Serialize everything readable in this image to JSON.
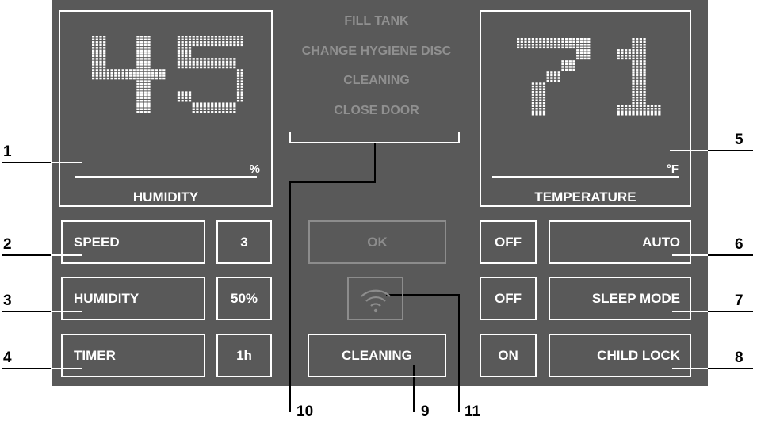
{
  "messages": [
    "FILL TANK",
    "CHANGE HYGIENE DISC",
    "CLEANING",
    "CLOSE DOOR"
  ],
  "humidity_display": {
    "value": "45",
    "unit": "%",
    "title": "HUMIDITY"
  },
  "temperature_display": {
    "value": "71",
    "unit": "°F",
    "title": "TEMPERATURE"
  },
  "left_controls": [
    {
      "label": "SPEED",
      "value": "3"
    },
    {
      "label": "HUMIDITY",
      "value": "50%"
    },
    {
      "label": "TIMER",
      "value": "1h"
    }
  ],
  "center": {
    "ok_label": "OK",
    "cleaning_label": "CLEANING",
    "wifi_icon": "wifi-icon"
  },
  "right_controls": [
    {
      "state": "OFF",
      "label": "AUTO"
    },
    {
      "state": "OFF",
      "label": "SLEEP MODE"
    },
    {
      "state": "ON",
      "label": "CHILD LOCK"
    }
  ],
  "callouts": [
    "1",
    "2",
    "3",
    "4",
    "5",
    "6",
    "7",
    "8",
    "9",
    "10",
    "11"
  ],
  "colors": {
    "panel": "#595959",
    "active": "#ffffff",
    "inactive": "#8c8c8c"
  }
}
